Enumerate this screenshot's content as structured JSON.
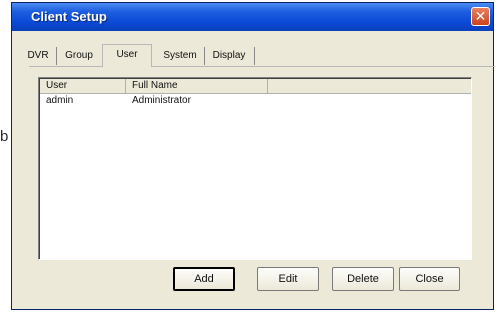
{
  "stray_text": "b",
  "window": {
    "title": "Client Setup",
    "close_glyph": "✕"
  },
  "tabs": [
    {
      "label": "DVR"
    },
    {
      "label": "Group"
    },
    {
      "label": "User"
    },
    {
      "label": "System"
    },
    {
      "label": "Display"
    }
  ],
  "active_tab": "User",
  "list": {
    "columns": [
      "User",
      "Full Name",
      ""
    ],
    "rows": [
      {
        "user": "admin",
        "full_name": "Administrator"
      }
    ]
  },
  "buttons": {
    "add": "Add",
    "edit": "Edit",
    "delete": "Delete",
    "close": "Close"
  },
  "colors": {
    "titlebar": "#0a49d6",
    "dialog_bg": "#ece9d8",
    "close_button": "#c9421d"
  },
  "icons": {
    "close": "close-icon"
  }
}
